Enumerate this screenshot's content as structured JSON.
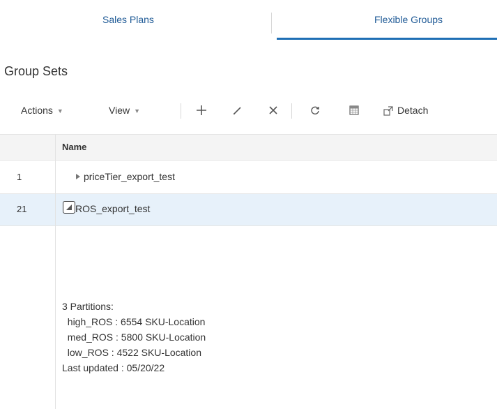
{
  "tabs": [
    {
      "label": "Sales Plans",
      "active": false
    },
    {
      "label": "Flexible Groups",
      "active": true
    }
  ],
  "accent_color": "#1f6fb5",
  "page_title": "Group Sets",
  "toolbar": {
    "actions_label": "Actions",
    "view_label": "View",
    "icons": [
      "add-icon",
      "edit-icon",
      "delete-icon",
      "refresh-icon",
      "freeze-icon",
      "detach-icon"
    ],
    "detach_label": "Detach"
  },
  "table": {
    "columns": [
      "",
      "Name"
    ],
    "rows": [
      {
        "num": "1",
        "name": "priceTier_export_test",
        "expanded": false
      },
      {
        "num": "21",
        "name": "ROS_export_test",
        "expanded": true
      }
    ],
    "selected_row_color": "#e7f1fa",
    "detail": {
      "partitions_title": "3 Partitions:",
      "partitions": [
        "high_ROS : 6554 SKU-Location",
        "med_ROS : 5800 SKU-Location",
        "low_ROS : 4522 SKU-Location"
      ],
      "last_updated": "Last updated : 05/20/22"
    }
  }
}
